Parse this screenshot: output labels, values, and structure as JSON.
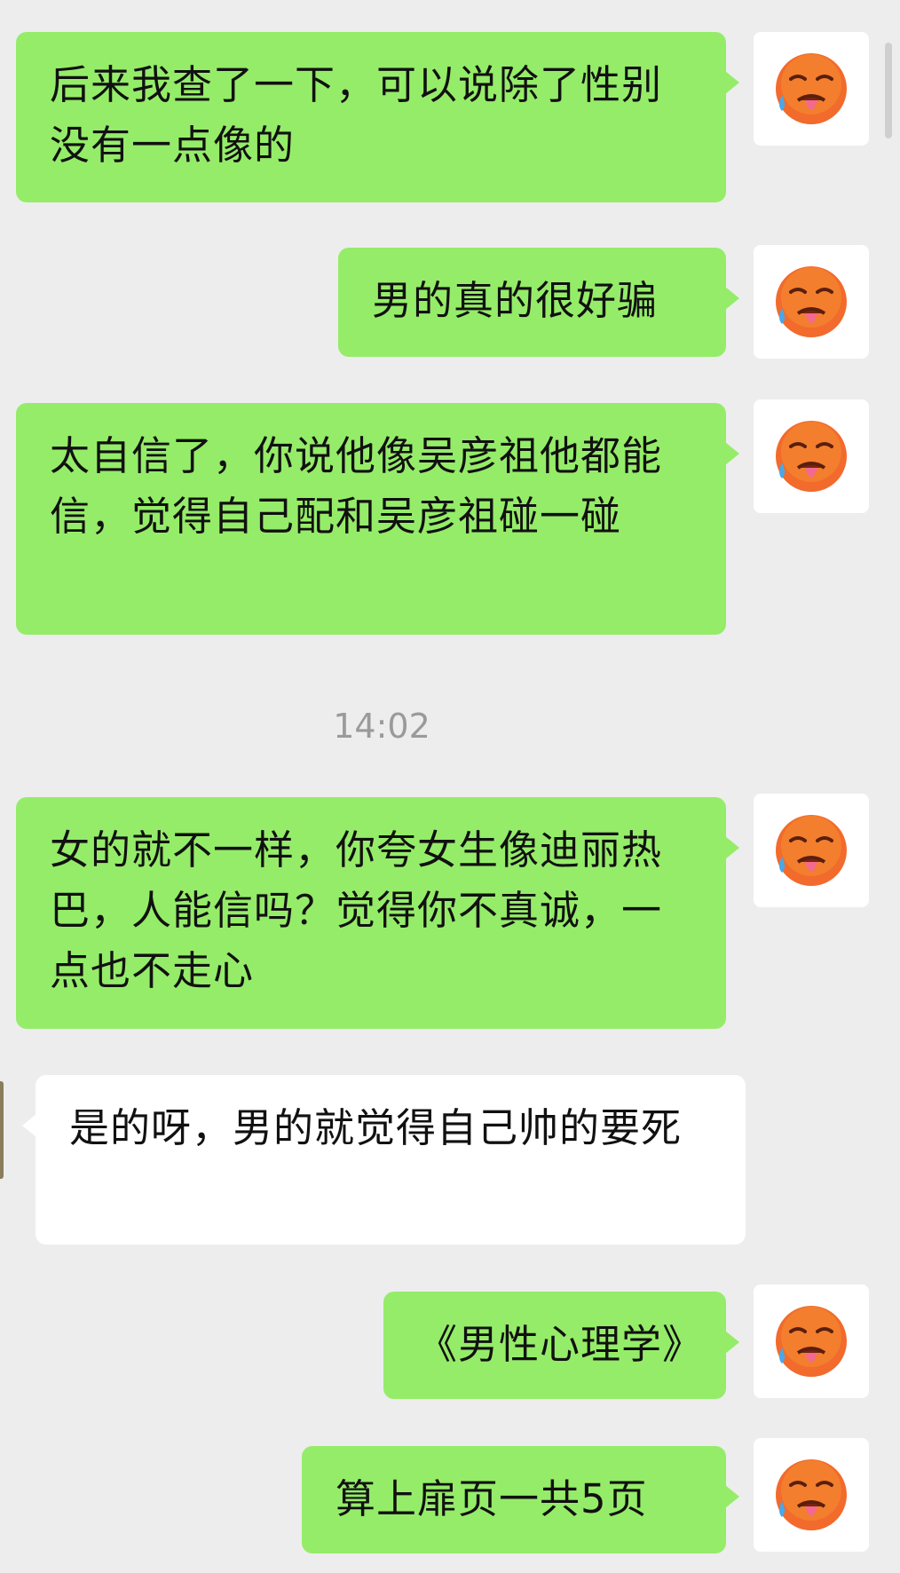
{
  "timestamp": "14:02",
  "avatar_icon": "hot-face-emoji-icon",
  "messages": [
    {
      "direction": "out",
      "text": "后来我查了一下，可以说除了性别没有一点像的"
    },
    {
      "direction": "out",
      "text": "男的真的很好骗"
    },
    {
      "direction": "out",
      "text": "太自信了，你说他像吴彦祖他都能信，觉得自己配和吴彦祖碰一碰"
    },
    {
      "direction": "out",
      "text": "女的就不一样，你夸女生像迪丽热巴，人能信吗？觉得你不真诚，一点也不走心"
    },
    {
      "direction": "in",
      "text": "是的呀，男的就觉得自己帅的要死"
    },
    {
      "direction": "out",
      "text": "《男性心理学》"
    },
    {
      "direction": "out",
      "text": "算上扉页一共5页"
    }
  ]
}
